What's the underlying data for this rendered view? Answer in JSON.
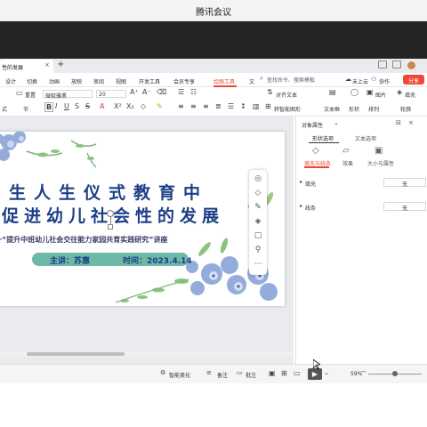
{
  "app": {
    "title": "腾讯会议"
  },
  "wps": {
    "doc_tab": "性的发展",
    "new_tab": "+",
    "menu": [
      "设计",
      "切换",
      "动画",
      "放映",
      "审阅",
      "视图",
      "开发工具",
      "会员专享",
      "绘图工具",
      "文"
    ],
    "menu_active_index": 8,
    "search_placeholder": "查找命令、搜索模板",
    "right_menu": [
      "未上云",
      "协作"
    ],
    "share": "分享",
    "toolbar": {
      "reset": "重置",
      "font_name": "微软雅黑",
      "font_size": "20",
      "format_label": "式",
      "section": "节",
      "paragraph": "对齐文本",
      "smart_shape": "转智能图形",
      "textbox": "文本框",
      "shape": "形状",
      "arrange": "排列",
      "picture": "图片",
      "fill": "填充",
      "outline": "轮廓"
    },
    "slide": {
      "title_line1": "生人生仪式教育中",
      "title_line2": "促进幼儿社会性的发展",
      "subtitle": "一“提升中班幼儿社会交往能力家园共育实践研究”讲座",
      "speaker": "主讲：苏惠",
      "time": "时间：2023.4.14"
    },
    "pane": {
      "title": "对象属性",
      "tabs": [
        "形状选项",
        "文本选项"
      ],
      "subtabs": [
        "填充与线条",
        "效果",
        "大小与属性"
      ],
      "fill_label": "填充",
      "fill_value": "无",
      "line_label": "线条",
      "line_value": "无"
    },
    "status": {
      "beautify": "智能美化",
      "notes": "备注",
      "comments": "批注",
      "zoom": "59%"
    }
  },
  "colors": {
    "accent": "#e94b35",
    "title_blue": "#1d3f88",
    "pill_green": "#6db9a5",
    "meeting_bg": "#242424"
  }
}
